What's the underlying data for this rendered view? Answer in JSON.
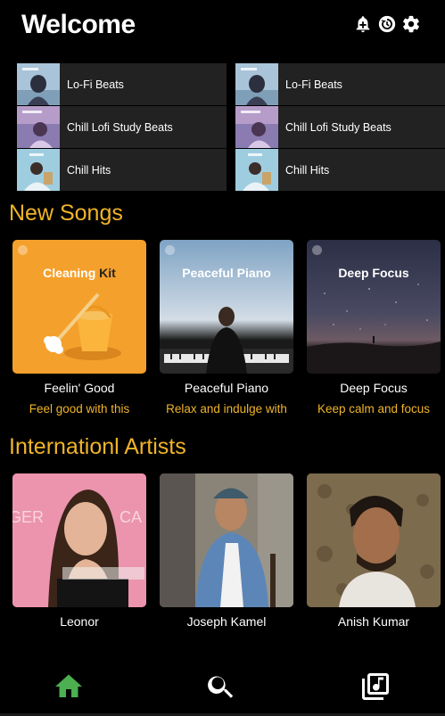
{
  "header": {
    "title": "Welcome",
    "icons": [
      "notification-add-icon",
      "history-icon",
      "settings-icon"
    ]
  },
  "quick_access": {
    "columns": [
      {
        "items": [
          {
            "label": "Lo-Fi Beats"
          },
          {
            "label": "Chill Lofi Study Beats"
          },
          {
            "label": "Chill Hits"
          }
        ]
      },
      {
        "items": [
          {
            "label": "Lo-Fi Beats"
          },
          {
            "label": "Chill Lofi Study Beats"
          },
          {
            "label": "Chill Hits"
          }
        ]
      }
    ]
  },
  "new_songs": {
    "title": "New Songs",
    "cards": [
      {
        "cover_text": "Cleaning",
        "cover_accent": "Kit",
        "name": "Feelin' Good",
        "description": "Feel good with this"
      },
      {
        "cover_text": "Peaceful Piano",
        "name": "Peaceful Piano",
        "description": "Relax and indulge with"
      },
      {
        "cover_text": "Deep Focus",
        "name": "Deep Focus",
        "description": "Keep calm and focus"
      }
    ]
  },
  "artists": {
    "title": "Internationl Artists",
    "cards": [
      {
        "name": "Leonor"
      },
      {
        "name": "Joseph Kamel"
      },
      {
        "name": "Anish Kumar"
      }
    ]
  },
  "bottom_nav": {
    "items": [
      "home-icon",
      "search-icon",
      "library-music-icon"
    ],
    "active": "home-icon"
  },
  "colors": {
    "accent": "#f0b429",
    "background": "#000000",
    "tile": "#222222",
    "nav_active": "#4caf50"
  }
}
